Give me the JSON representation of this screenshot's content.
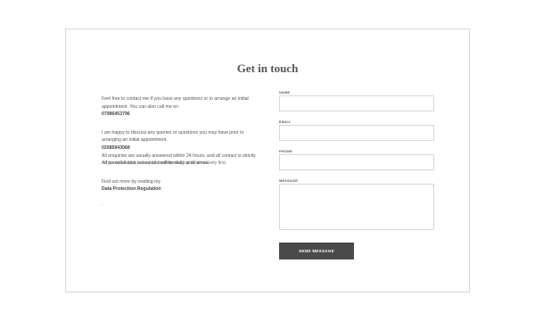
{
  "contact": {
    "title": "Get in touch",
    "intro": "Feel free to contact me if you have any questions or to arrange an initial appointment. You can also call me on",
    "phone1": "07986453796",
    "happy": "I am happy to discuss any queries or questions you may have prior to arranging an initial appointment.",
    "phone2": "02085943068",
    "enquiries": "All enquiries are usually answered within 24 hours, and all contact is strictly",
    "overlap_a": "All personal data is treated confidentially at all times.",
    "overlap_b": "of a confidential nature and will be dealt with sensitively first.",
    "find_more": "Find out more by reading my",
    "gdpr_link": "Data Protection Regulation",
    "dot": "."
  },
  "form": {
    "name_label": "NAME",
    "email_label": "EMAIL",
    "phone_label": "PHONE",
    "message_label": "MESSAGE",
    "name_value": "",
    "email_value": "",
    "phone_value": "",
    "message_value": "",
    "send_label": "SEND MESSAGE"
  },
  "colors": {
    "button_bg": "#4a4a4a",
    "border": "#d6d6d6",
    "text": "#555555"
  }
}
